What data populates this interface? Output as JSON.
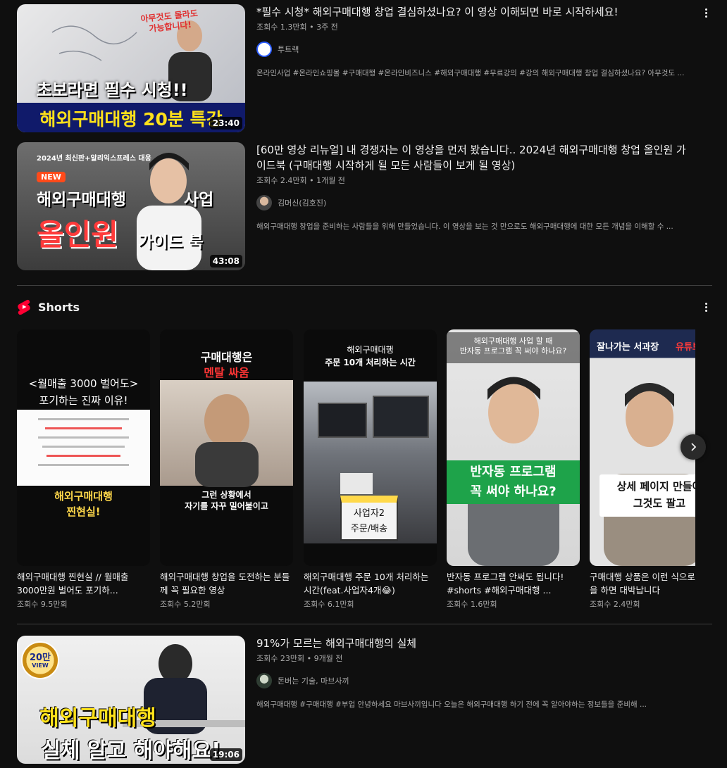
{
  "videos": [
    {
      "title": "*필수 시청* 해외구매대행 창업 결심하셨나요? 이 영상 이해되면 바로 시작하세요!",
      "meta": "조회수 1.3만회 • 3주 전",
      "channel": "투트랙",
      "description": "온라인사업 #온라인쇼핑몰 #구매대행 #온라인비즈니스 #해외구매대행 #무료강의 #강의 해외구매대행 창업 결심하셨나요? 아무것도 ...",
      "duration": "23:40",
      "thumb_text": {
        "line1": "초보라면 필수 시청!!",
        "line2": "해외구매대행 20분 특강",
        "tag": "아무것도 몰라도 가능합니다!"
      }
    },
    {
      "title": "[60만 영상 리뉴얼] 내 경쟁자는 이 영상을 먼저 봤습니다.. 2024년 해외구매대행 창업 올인원 가이드북 (구매대행 시작하게 될 모든 사람들이 보게 될 영상)",
      "meta": "조회수 2.4만회 • 1개월 전",
      "channel": "김머신(김호진)",
      "description": "해외구매대행 창업을 준비하는 사람들을 위해 만들었습니다. 이 영상을 보는 것 만으로도 해외구매대행에 대한 모든 개념을 이해할 수 ...",
      "duration": "43:08",
      "thumb_text": {
        "top": "2024년 최신판+알리익스프레스 대응",
        "badge": "NEW",
        "line1": "해외구매대행",
        "line1b": "사업",
        "line2": "올인원",
        "line2b": "가이드 북"
      }
    },
    {
      "title": "91%가 모르는 해외구매대행의 실체",
      "meta": "조회수 23만회 • 9개월 전",
      "channel": "돈버는 기술, 마브사끼",
      "description": "해외구매대행 #구매대행 #부업 안녕하세요 마브사끼입니다 오늘은 해외구매대행 하기 전에 꼭 알아야하는 정보들을 준비해 ...",
      "duration": "19:06",
      "thumb_text": {
        "medal1": "20만",
        "medal2": "VIEW",
        "line1": "해외구매대행",
        "line2": "실체 알고 해야해요!"
      }
    }
  ],
  "shorts": {
    "section_title": "Shorts",
    "items": [
      {
        "title": "해외구매대행 찐현실 // 월매출 3000만원 벌어도 포기하...",
        "views": "조회수 9.5만회",
        "thumb_text": {
          "t1": "<월매출 3000 벌어도>",
          "t2": "포기하는 진짜 이유!",
          "b1": "해외구매대행",
          "b2": "찐현실!"
        }
      },
      {
        "title": "해외구매대행 창업을 도전하는 분들께 꼭 필요한 영상",
        "views": "조회수 5.2만회",
        "thumb_text": {
          "t1": "구매대행은",
          "t2": "멘탈 싸움",
          "b1": "그런 상황에서",
          "b2": "자기를 자꾸 밀어붙이고"
        }
      },
      {
        "title": "해외구매대행 주문 10개 처리하는 시간(feat.사업자4개😂)",
        "views": "조회수 6.1만회",
        "thumb_text": {
          "t1": "해외구매대행",
          "t2": "주문 10개 처리하는 시간",
          "b1": "사업자2",
          "b2": "주문/배송"
        }
      },
      {
        "title": "반자동 프로그램 안써도 됩니다! #shorts #해외구매대행 ...",
        "views": "조회수 1.6만회",
        "thumb_text": {
          "t1": "해외구매대행 사업 할 때",
          "t2": "반자동 프로그램 꼭 써야 하나요?",
          "b1": "반자동 프로그램",
          "b2": "꼭 써야 하나요?"
        }
      },
      {
        "title": "구매대행 상품은 이런 식으로 마케팅을 하면 대박납니다",
        "views": "조회수 2.4만회",
        "thumb_text": {
          "t1": "잘나가는 서과장",
          "t1b": "유튜브러",
          "b1": "상세 페이지 만들어",
          "b2": "그것도 팔고"
        }
      }
    ]
  },
  "icons": {
    "more": "more-vert-icon",
    "shorts": "shorts-logo-icon",
    "next": "chevron-right-icon"
  },
  "colors": {
    "background": "#0f0f0f",
    "text": "#f1f1f1",
    "meta": "#aaaaaa",
    "shorts_red": "#ff0033"
  }
}
